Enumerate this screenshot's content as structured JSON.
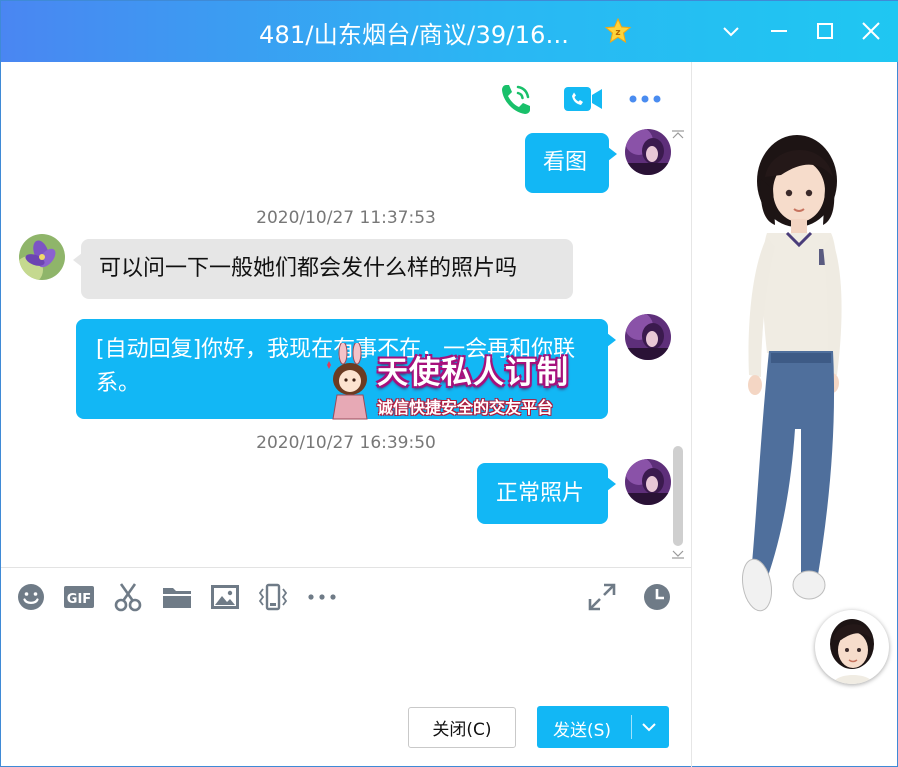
{
  "window": {
    "title": "481/山东烟台/商议/39/16..."
  },
  "messages": [
    {
      "side": "me",
      "text": "看图"
    },
    {
      "side": "them",
      "time": "2020/10/27 11:37:53",
      "text": "可以问一下一般她们都会发什么样的照片吗"
    },
    {
      "side": "me",
      "text": "[自动回复]你好，我现在有事不在，一会再和你联系。"
    },
    {
      "side": "me",
      "time": "2020/10/27 16:39:50",
      "text": "正常照片"
    }
  ],
  "watermark": {
    "title": "天使私人订制",
    "subtitle": "诚信快捷安全的交友平台"
  },
  "input": {
    "value": ""
  },
  "buttons": {
    "close_label": "关闭(C)",
    "send_label": "发送(S)"
  },
  "colors": {
    "accent": "#12b7f5",
    "title_gradient_start": "#4a86f2",
    "title_gradient_end": "#1fc7f2",
    "incoming_bubble": "#e6e6e6",
    "phone_green": "#19c06a"
  }
}
